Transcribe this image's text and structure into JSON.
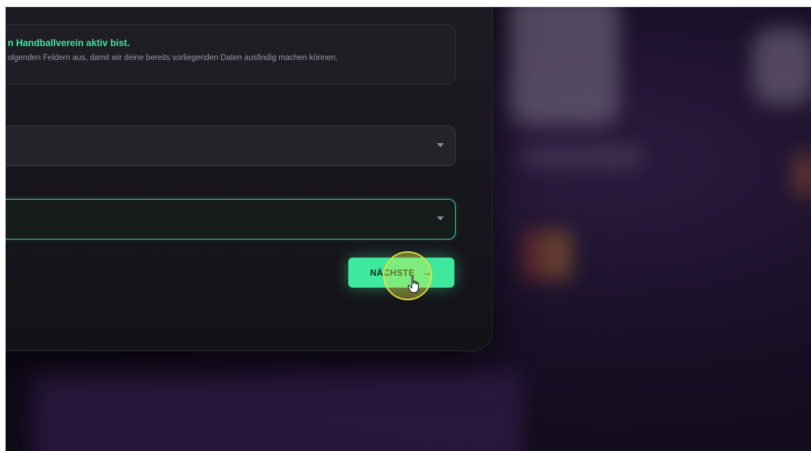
{
  "info": {
    "title": "n Handballverein aktiv bist.",
    "text": "olgenden Feldern aus, damit wir deine bereits vorliegenden Daten ausfindig machen können."
  },
  "fields": {
    "select_1_value": "",
    "select_2_value": ""
  },
  "buttons": {
    "next_label": "NÄCHSTE",
    "next_icon": "arrow-right-icon"
  },
  "colors": {
    "accent": "#3ee89c",
    "highlight": "#e9e23a"
  }
}
